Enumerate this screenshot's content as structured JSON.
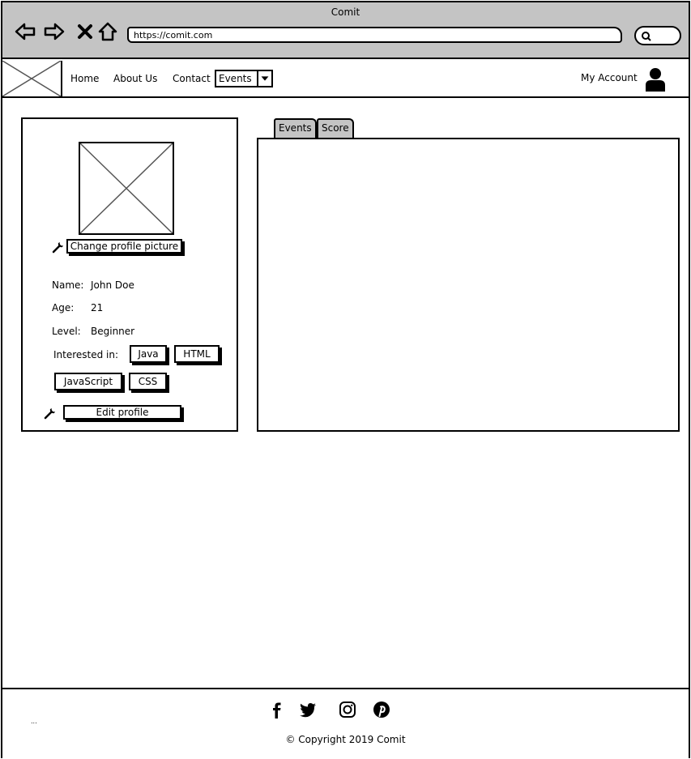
{
  "window": {
    "title": "Comit",
    "url": "https://comit.com"
  },
  "navbar": {
    "links": [
      "Home",
      "About Us",
      "Contact"
    ],
    "events_select": {
      "selected": "Events"
    },
    "account_label": "My Account"
  },
  "profile": {
    "change_picture_label": "Change profile picture",
    "fields": [
      {
        "label": "Name:",
        "value": "John Doe"
      },
      {
        "label": "Age:",
        "value": "21"
      },
      {
        "label": "Level:",
        "value": "Beginner"
      }
    ],
    "interests_label": "Interested in:",
    "interests": [
      "Java",
      "HTML",
      "JavaScript",
      "CSS"
    ],
    "edit_label": "Edit profile"
  },
  "tabs": [
    "Events",
    "Score"
  ],
  "footer": {
    "ellipsis": "...",
    "social_icons": [
      "facebook-icon",
      "twitter-icon",
      "instagram-icon",
      "pinterest-icon"
    ],
    "copyright": "© Copyright 2019 Comit"
  },
  "colors": {
    "chrome": "#c4c4c4",
    "border": "#000000",
    "background": "#ffffff"
  }
}
